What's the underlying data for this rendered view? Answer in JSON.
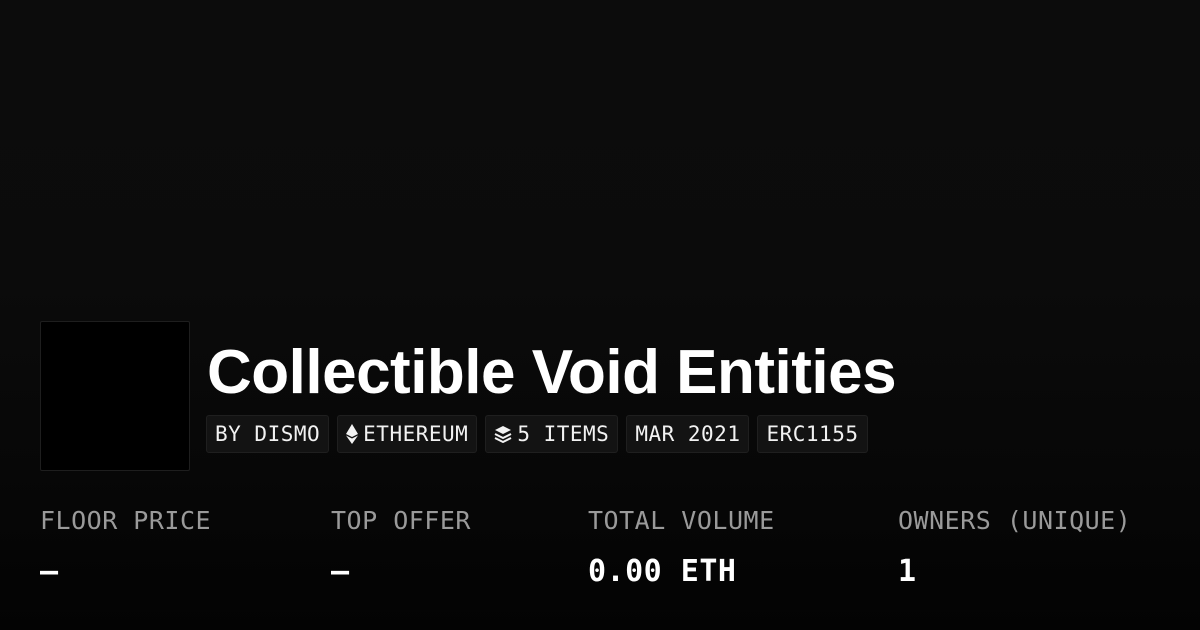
{
  "collection": {
    "title": "Collectible Void Entities",
    "thumbnail_color": "#000000"
  },
  "tags": [
    {
      "label": "BY DISMO",
      "icon": ""
    },
    {
      "label": "ETHEREUM",
      "icon": "ethereum-icon"
    },
    {
      "label": "5 ITEMS",
      "icon": "layers-icon"
    },
    {
      "label": "MAR 2021",
      "icon": ""
    },
    {
      "label": "ERC1155",
      "icon": ""
    }
  ],
  "stats": [
    {
      "label": "FLOOR PRICE",
      "value": "–"
    },
    {
      "label": "TOP OFFER",
      "value": "–"
    },
    {
      "label": "TOTAL VOLUME",
      "value": "0.00 ETH"
    },
    {
      "label": "OWNERS (UNIQUE)",
      "value": "1"
    }
  ],
  "colors": {
    "background": "#0b0b0b",
    "text": "#ffffff",
    "muted_label": "#9a9a9a",
    "tag_background": "#131313"
  }
}
